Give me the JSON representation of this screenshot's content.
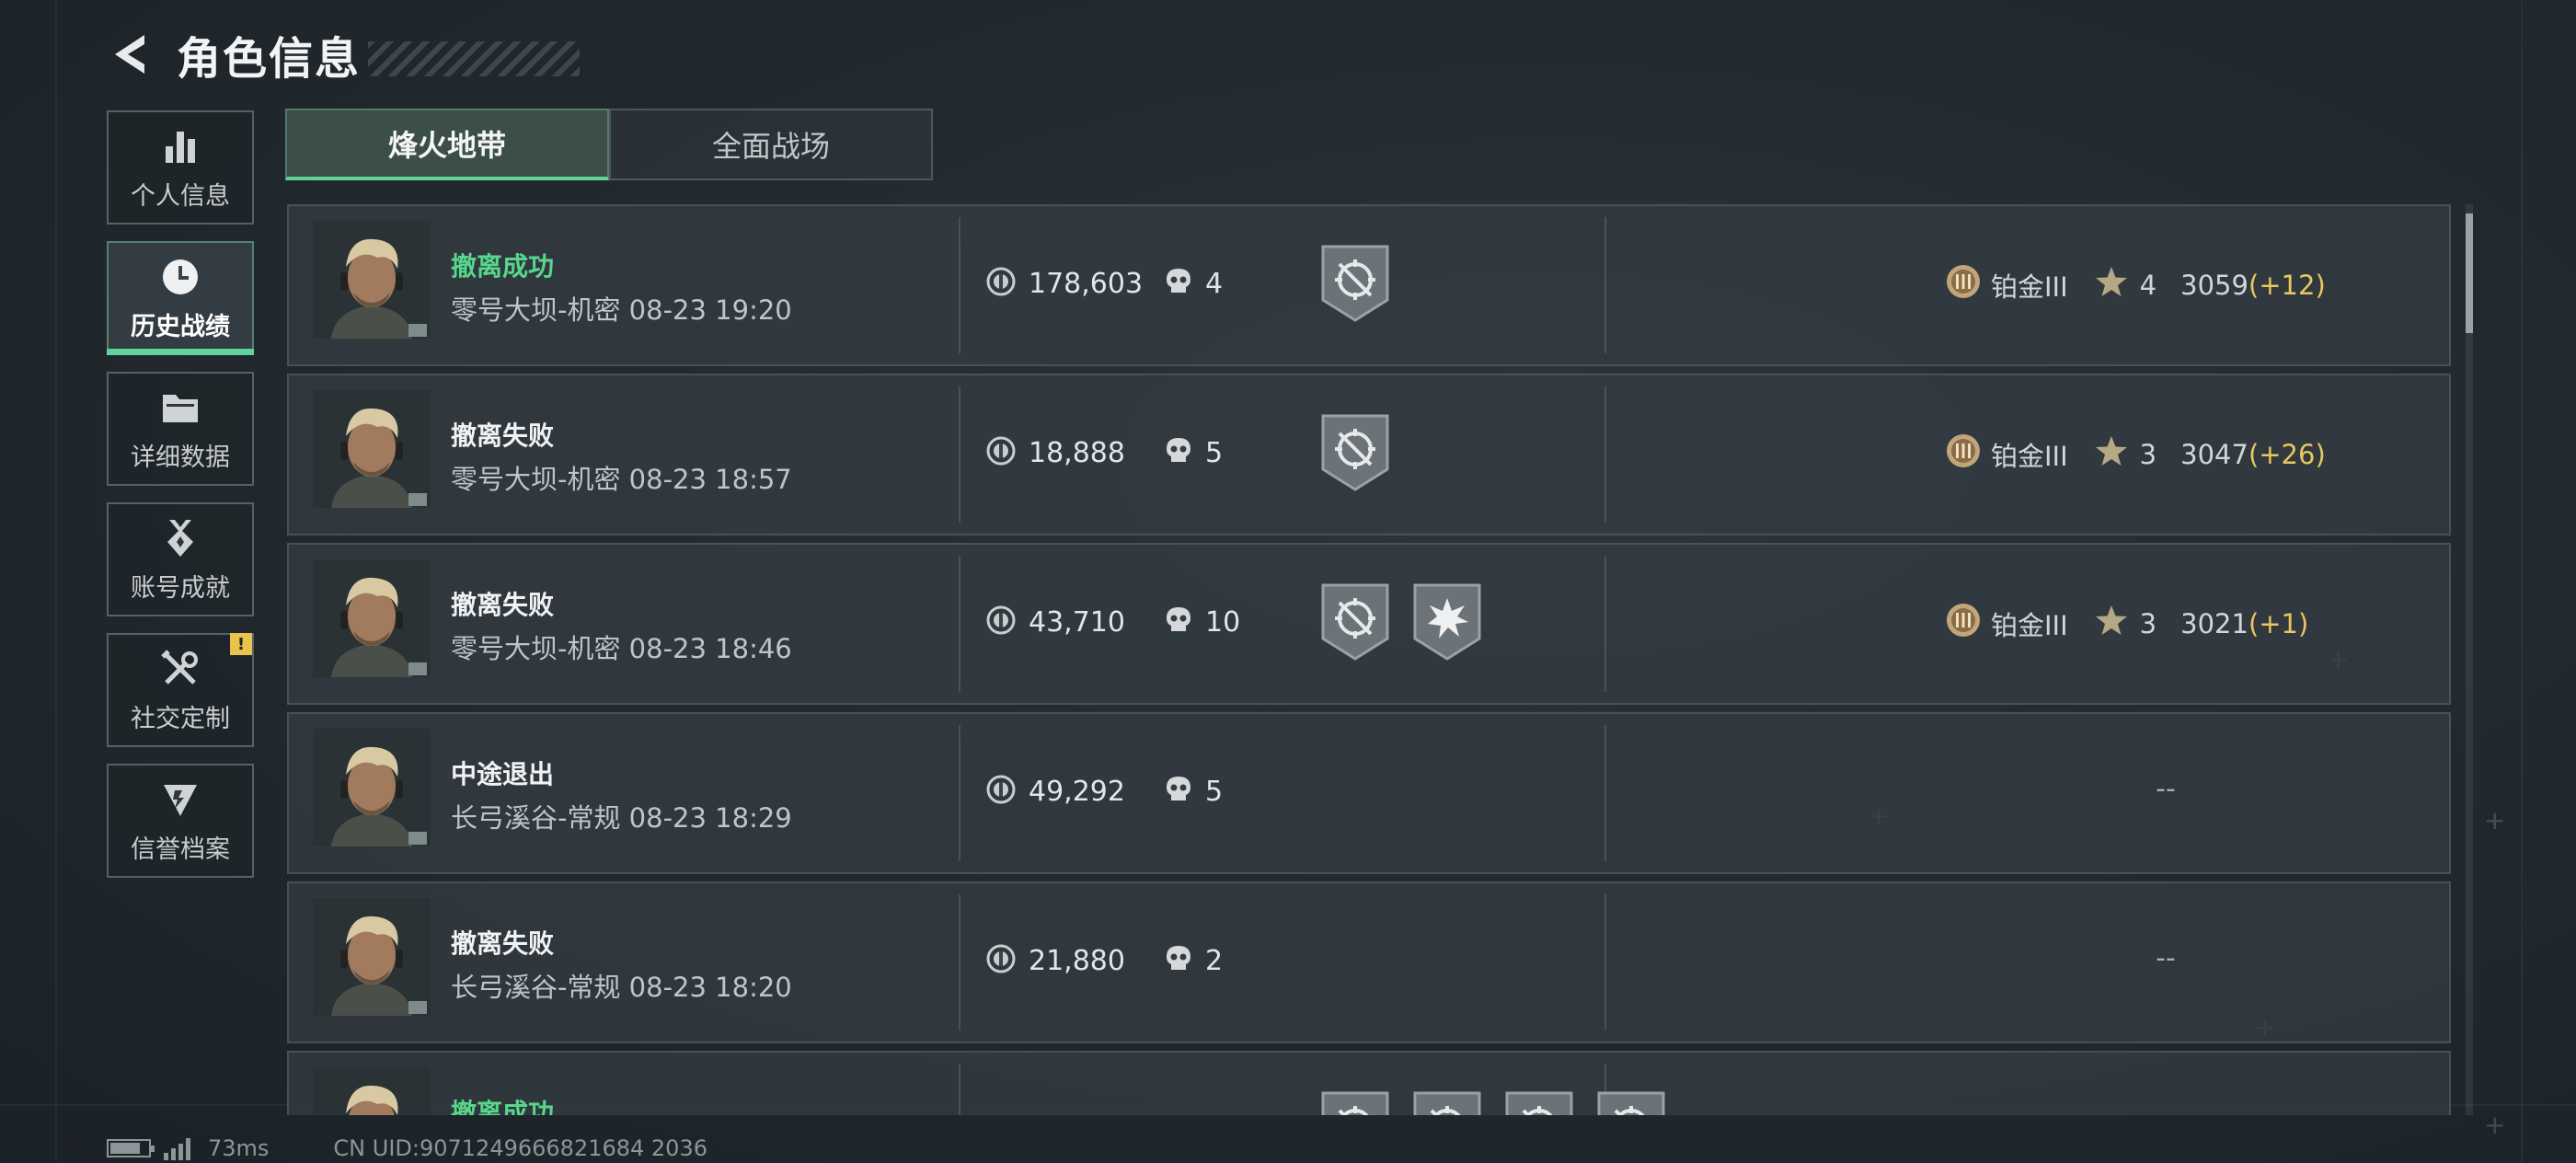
{
  "header": {
    "title": "角色信息"
  },
  "sidebar": {
    "items": [
      {
        "label": "个人信息",
        "icon": "bar-chart-icon"
      },
      {
        "label": "历史战绩",
        "icon": "clock-icon",
        "active": true
      },
      {
        "label": "详细数据",
        "icon": "folder-icon"
      },
      {
        "label": "账号成就",
        "icon": "achievement-icon"
      },
      {
        "label": "社交定制",
        "icon": "tools-icon",
        "badge": "!"
      },
      {
        "label": "信誉档案",
        "icon": "credit-shield-icon"
      }
    ]
  },
  "tabs": [
    {
      "label": "烽火地带",
      "active": true
    },
    {
      "label": "全面战场",
      "active": false
    }
  ],
  "colors": {
    "accent": "#5fd39a",
    "success": "#58d68d",
    "delta": "#e7c75f",
    "badge": "#e9c44a"
  },
  "matches": [
    {
      "status": "撤离成功",
      "status_type": "success",
      "map_time": "零号大坝-机密 08-23 19:20",
      "coins": "178,603",
      "kills": "4",
      "medals": [
        "target-medal-icon"
      ],
      "rank": {
        "name": "铂金III",
        "stars": "4",
        "score": "3059",
        "delta": "(+12)"
      }
    },
    {
      "status": "撤离失败",
      "status_type": "fail",
      "map_time": "零号大坝-机密 08-23 18:57",
      "coins": "18,888",
      "kills": "5",
      "medals": [
        "target-medal-icon"
      ],
      "rank": {
        "name": "铂金III",
        "stars": "3",
        "score": "3047",
        "delta": "(+26)"
      }
    },
    {
      "status": "撤离失败",
      "status_type": "fail",
      "map_time": "零号大坝-机密 08-23 18:46",
      "coins": "43,710",
      "kills": "10",
      "medals": [
        "target-medal-icon",
        "explosion-medal-icon"
      ],
      "rank": {
        "name": "铂金III",
        "stars": "3",
        "score": "3021",
        "delta": "(+1)"
      }
    },
    {
      "status": "中途退出",
      "status_type": "quit",
      "map_time": "长弓溪谷-常规 08-23 18:29",
      "coins": "49,292",
      "kills": "5",
      "medals": [],
      "no_rank": "--"
    },
    {
      "status": "撤离失败",
      "status_type": "fail",
      "map_time": "长弓溪谷-常规 08-23 18:20",
      "coins": "21,880",
      "kills": "2",
      "medals": [],
      "no_rank": "--"
    },
    {
      "status": "撤离成功",
      "status_type": "success",
      "map_time": "",
      "coins": "",
      "kills": "",
      "medals": [
        "target-medal-icon",
        "target-medal-icon",
        "target-medal-icon",
        "target-medal-icon"
      ]
    }
  ],
  "footer": {
    "ping": "73ms",
    "uid": "CN UID:9071249666821684 2036"
  }
}
